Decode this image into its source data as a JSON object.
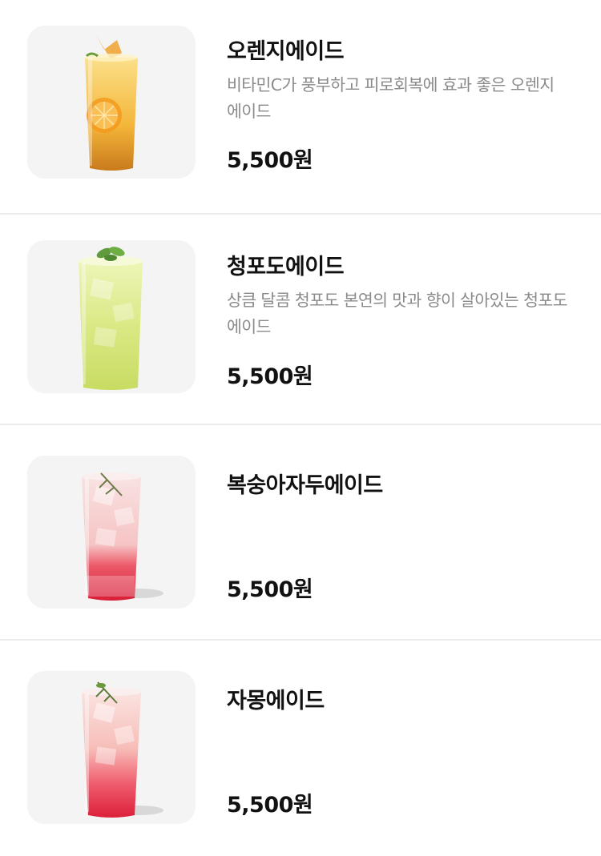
{
  "menu": {
    "items": [
      {
        "name": "오렌지에이드",
        "description": "비타민C가 풍부하고 피로회복에 효과 좋은 오렌지 에이드",
        "price": "5,500원",
        "image_icon": "orange-ade-glass"
      },
      {
        "name": "청포도에이드",
        "description": "상큼 달콤 청포도 본연의 맛과 향이 살아있는 청포도 에이드",
        "price": "5,500원",
        "image_icon": "green-grape-ade-glass"
      },
      {
        "name": "복숭아자두에이드",
        "description": "",
        "price": "5,500원",
        "image_icon": "peach-plum-ade-glass"
      },
      {
        "name": "자몽에이드",
        "description": "",
        "price": "5,500원",
        "image_icon": "grapefruit-ade-glass"
      }
    ]
  },
  "colors": {
    "orange_drink": "#f5b93a",
    "green_drink": "#d7e77c",
    "red_drink": "#e8384e",
    "pink_drink": "#f7c9c9"
  }
}
